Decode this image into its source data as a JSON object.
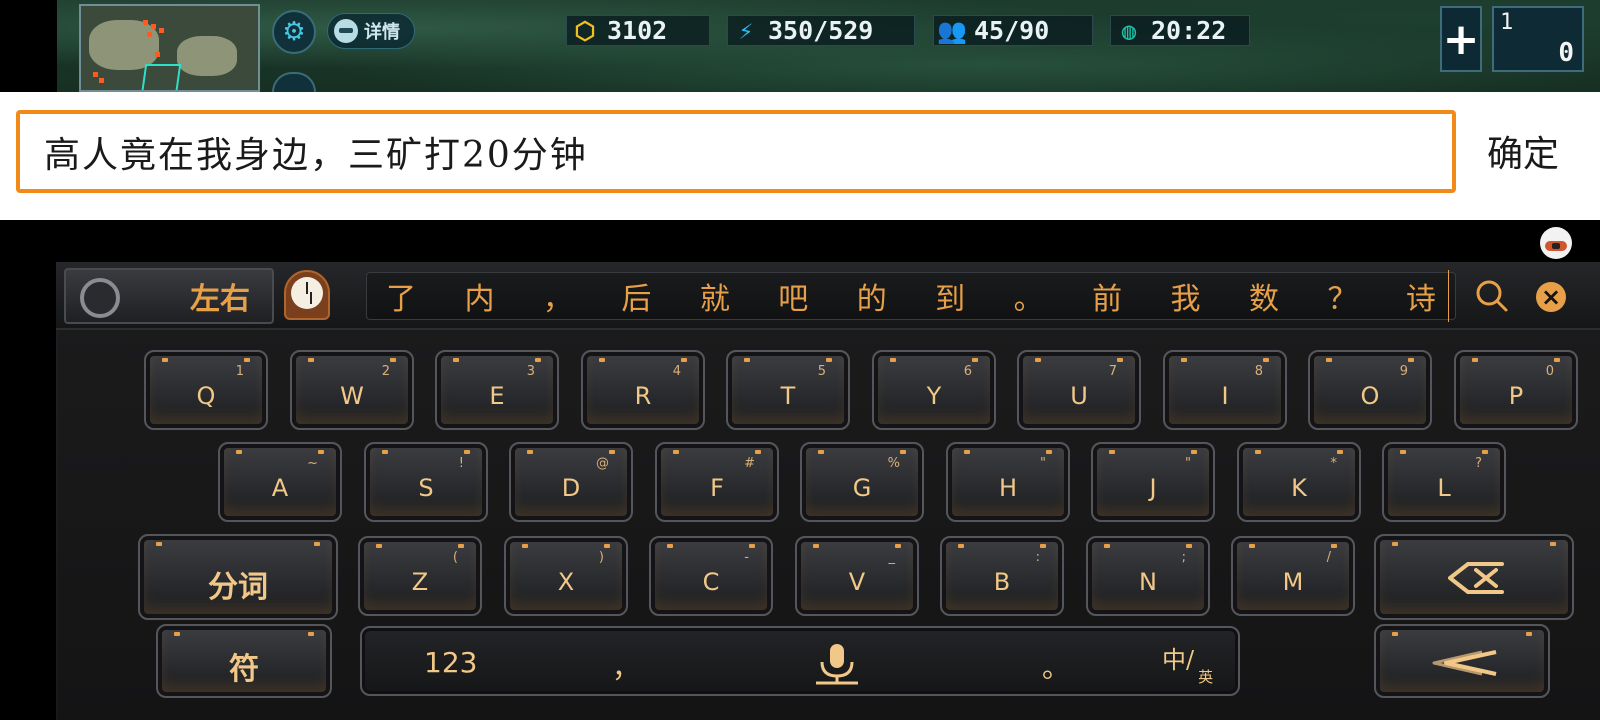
{
  "hud": {
    "detail_label": "详情",
    "gold": "3102",
    "energy": "350/529",
    "population": "45/90",
    "timer": "20:22",
    "slot_number": "1",
    "slot_count": "0"
  },
  "input": {
    "text": "高人竟在我身边，三矿打20分钟",
    "confirm_label": "确定"
  },
  "keyboard": {
    "layout_badge": "左右",
    "candidates": [
      "了",
      "内",
      "，",
      "后",
      "就",
      "吧",
      "的",
      "到",
      "。",
      "前",
      "我",
      "数",
      "？",
      "诗"
    ],
    "rows": [
      [
        {
          "key": "Q",
          "sub": "1"
        },
        {
          "key": "W",
          "sub": "2"
        },
        {
          "key": "E",
          "sub": "3"
        },
        {
          "key": "R",
          "sub": "4"
        },
        {
          "key": "T",
          "sub": "5"
        },
        {
          "key": "Y",
          "sub": "6"
        },
        {
          "key": "U",
          "sub": "7"
        },
        {
          "key": "I",
          "sub": "8"
        },
        {
          "key": "O",
          "sub": "9"
        },
        {
          "key": "P",
          "sub": "0"
        }
      ],
      [
        {
          "key": "A",
          "sub": "~"
        },
        {
          "key": "S",
          "sub": "!"
        },
        {
          "key": "D",
          "sub": "@"
        },
        {
          "key": "F",
          "sub": "#"
        },
        {
          "key": "G",
          "sub": "%"
        },
        {
          "key": "H",
          "sub": "\""
        },
        {
          "key": "J",
          "sub": "\""
        },
        {
          "key": "K",
          "sub": "*"
        },
        {
          "key": "L",
          "sub": "?"
        }
      ],
      [
        {
          "key": "Z",
          "sub": "("
        },
        {
          "key": "X",
          "sub": ")"
        },
        {
          "key": "C",
          "sub": "-"
        },
        {
          "key": "V",
          "sub": "_"
        },
        {
          "key": "B",
          "sub": ":"
        },
        {
          "key": "N",
          "sub": ";"
        },
        {
          "key": "M",
          "sub": "/"
        }
      ]
    ],
    "segment_label": "分词",
    "symbol_label": "符",
    "num_label": "123",
    "comma": "，",
    "period": "。",
    "lang_cn": "中",
    "lang_en": "英"
  },
  "colors": {
    "input_border": "#f28a17",
    "key_text": "#f1c888",
    "accent": "#e8a048"
  }
}
